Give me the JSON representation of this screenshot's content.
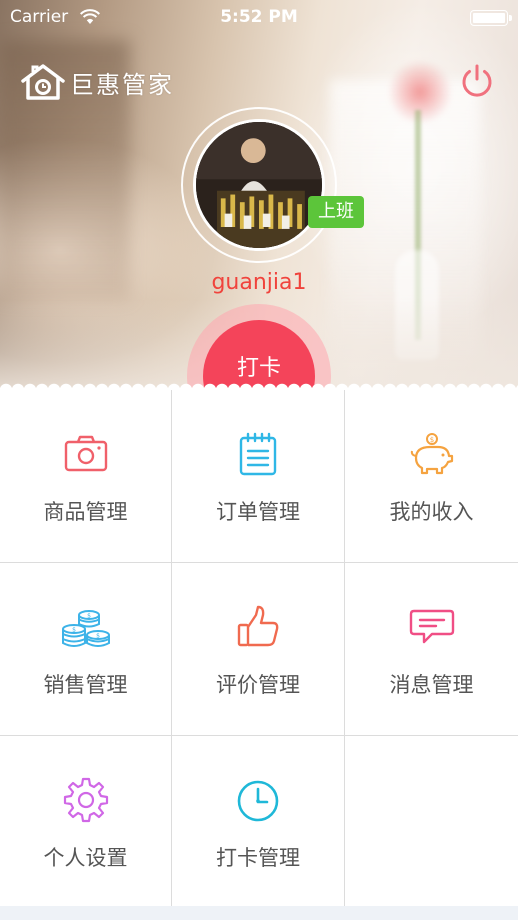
{
  "status_bar": {
    "carrier": "Carrier",
    "time": "5:52 PM"
  },
  "header": {
    "app_name": "巨惠管家",
    "icon": "power-icon"
  },
  "profile": {
    "username": "guanjia1",
    "duty_badge": "上班"
  },
  "punch_button": {
    "label": "打卡"
  },
  "menu": {
    "items": [
      {
        "label": "商品管理",
        "icon": "camera-icon",
        "color": "#f0606a"
      },
      {
        "label": "订单管理",
        "icon": "notepad-icon",
        "color": "#2fb7e6"
      },
      {
        "label": "我的收入",
        "icon": "piggy-bank-icon",
        "color": "#f5a340"
      },
      {
        "label": "销售管理",
        "icon": "coins-icon",
        "color": "#3db3e8"
      },
      {
        "label": "评价管理",
        "icon": "thumbs-up-icon",
        "color": "#f06a4f"
      },
      {
        "label": "消息管理",
        "icon": "message-icon",
        "color": "#f04e85"
      },
      {
        "label": "个人设置",
        "icon": "gear-icon",
        "color": "#d067e6"
      },
      {
        "label": "打卡管理",
        "icon": "clock-icon",
        "color": "#1fb8d8"
      }
    ]
  },
  "colors": {
    "accent": "#f4445a",
    "username": "#f0433c",
    "badge": "#5cc53a"
  }
}
